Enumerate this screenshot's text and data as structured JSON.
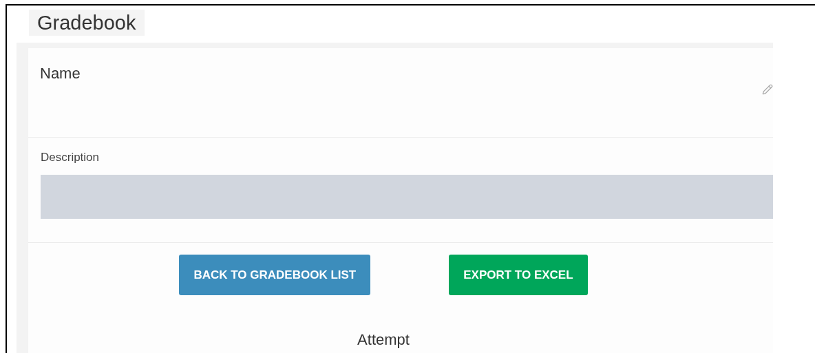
{
  "title": "Gradebook",
  "name_label": "Name",
  "description_label": "Description",
  "buttons": [
    {
      "label": "BACK TO GRADEBOOK LIST",
      "kind": "back"
    },
    {
      "label": "EXPORT TO EXCEL",
      "kind": "export"
    }
  ],
  "section_heading": "Attempt"
}
